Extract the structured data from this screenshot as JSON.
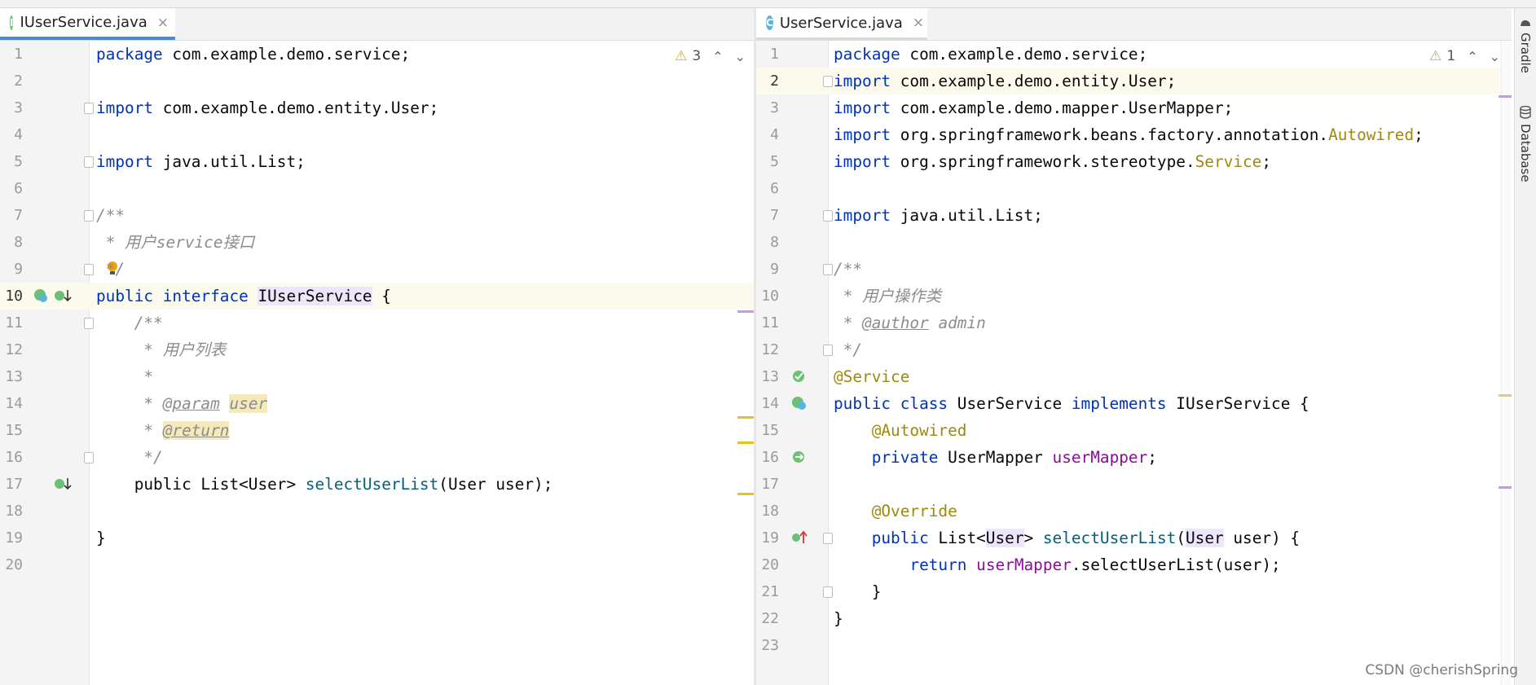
{
  "left_editor": {
    "tab": {
      "label": "IUserService.java",
      "icon": "interface-icon",
      "icon_letter": "I",
      "close": "×"
    },
    "inspection": {
      "warn_icon": "⚠",
      "count": "3",
      "up": "⌃",
      "down": "⌄"
    },
    "lines": [
      {
        "n": "1",
        "t": "package com.example.demo.service;"
      },
      {
        "n": "2",
        "t": ""
      },
      {
        "n": "3",
        "t": "import com.example.demo.entity.User;"
      },
      {
        "n": "4",
        "t": ""
      },
      {
        "n": "5",
        "t": "import java.util.List;"
      },
      {
        "n": "6",
        "t": ""
      },
      {
        "n": "7",
        "t": "/**"
      },
      {
        "n": "8",
        "t": " * 用户service接口"
      },
      {
        "n": "9",
        "t": " */"
      },
      {
        "n": "10",
        "t": "public interface IUserService {"
      },
      {
        "n": "11",
        "t": "    /**"
      },
      {
        "n": "12",
        "t": "     * 用户列表"
      },
      {
        "n": "13",
        "t": "     *"
      },
      {
        "n": "14",
        "t": "     * @param user"
      },
      {
        "n": "15",
        "t": "     * @return"
      },
      {
        "n": "16",
        "t": "     */"
      },
      {
        "n": "17",
        "t": "    public List<User> selectUserList(User user);"
      },
      {
        "n": "18",
        "t": ""
      },
      {
        "n": "19",
        "t": "}"
      },
      {
        "n": "20",
        "t": ""
      }
    ]
  },
  "right_editor": {
    "tab": {
      "label": "UserService.java",
      "icon": "class-icon",
      "icon_letter": "C",
      "close": "×"
    },
    "inspection": {
      "warn_icon": "⚠",
      "count": "1",
      "up": "⌃",
      "down": "⌄"
    },
    "lines": [
      {
        "n": "1",
        "t": "package com.example.demo.service;"
      },
      {
        "n": "2",
        "t": "import com.example.demo.entity.User;"
      },
      {
        "n": "3",
        "t": "import com.example.demo.mapper.UserMapper;"
      },
      {
        "n": "4",
        "t": "import org.springframework.beans.factory.annotation.Autowired;"
      },
      {
        "n": "5",
        "t": "import org.springframework.stereotype.Service;"
      },
      {
        "n": "6",
        "t": ""
      },
      {
        "n": "7",
        "t": "import java.util.List;"
      },
      {
        "n": "8",
        "t": ""
      },
      {
        "n": "9",
        "t": "/**"
      },
      {
        "n": "10",
        "t": " * 用户操作类"
      },
      {
        "n": "11",
        "t": " * @author admin"
      },
      {
        "n": "12",
        "t": " */"
      },
      {
        "n": "13",
        "t": "@Service"
      },
      {
        "n": "14",
        "t": "public class UserService implements IUserService {"
      },
      {
        "n": "15",
        "t": "    @Autowired"
      },
      {
        "n": "16",
        "t": "    private UserMapper userMapper;"
      },
      {
        "n": "17",
        "t": ""
      },
      {
        "n": "18",
        "t": "    @Override"
      },
      {
        "n": "19",
        "t": "    public List<User> selectUserList(User user) {"
      },
      {
        "n": "20",
        "t": "        return userMapper.selectUserList(user);"
      },
      {
        "n": "21",
        "t": "    }"
      },
      {
        "n": "22",
        "t": "}"
      },
      {
        "n": "23",
        "t": ""
      }
    ]
  },
  "sidebar": {
    "gradle": "Gradle",
    "database": "Database"
  },
  "watermark": "CSDN @cherishSpring",
  "colors": {
    "keyword": "#0033b3",
    "annotation": "#9e880d",
    "comment": "#8c8c8c",
    "field": "#871094",
    "method": "#00627a",
    "tab_active": "#4a88d8"
  }
}
